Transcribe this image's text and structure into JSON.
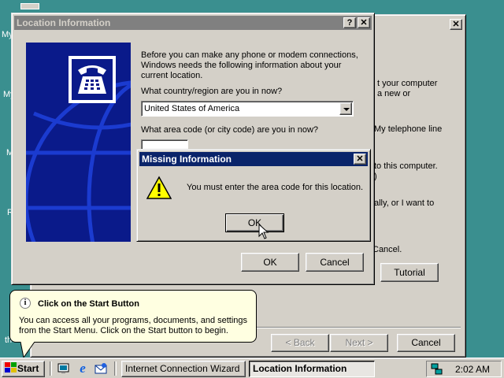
{
  "desktop": {
    "icon_labels": [
      "My",
      "My",
      "M",
      "R",
      "th"
    ]
  },
  "back_window": {
    "close_glyph": "✕",
    "text_lines": [
      "t your computer",
      "a new or",
      "My telephone line",
      "to this computer.",
      ")",
      "ally, or I want to",
      "Cancel."
    ],
    "tutorial_label": "Tutorial",
    "back_label": "< Back",
    "next_label": "Next >",
    "cancel_label": "Cancel"
  },
  "location_dialog": {
    "title": "Location Information",
    "help_glyph": "?",
    "close_glyph": "✕",
    "intro": "Before you can make any phone or modem connections, Windows needs the following information about your current location.",
    "country_question": "What country/region are you in now?",
    "country_value": "United States of America",
    "area_code_question": "What area code (or city code) are you in now?",
    "area_code_value": "",
    "ok_label": "OK",
    "cancel_label": "Cancel"
  },
  "missing_dialog": {
    "title": "Missing Information",
    "close_glyph": "✕",
    "message": "You must enter the area code for this location.",
    "ok_label": "OK",
    "icon": "warning-icon"
  },
  "tooltip": {
    "title": "Click on the Start Button",
    "body": "You can access all your programs, documents, and settings from the Start Menu. Click on the Start button to begin.",
    "icon": "info-icon"
  },
  "taskbar": {
    "start_label": "Start",
    "tasks": [
      "Internet Connection Wizard",
      "Location Information"
    ],
    "clock": "2:02 AM",
    "quick_launch": [
      "show-desktop-icon",
      "internet-explorer-icon",
      "outlook-express-icon"
    ]
  },
  "colors": {
    "desktop": "#3a8f8f",
    "active_title": "#0a246a",
    "inactive_title": "#808080",
    "panel_blue": "#0a1a8a"
  }
}
